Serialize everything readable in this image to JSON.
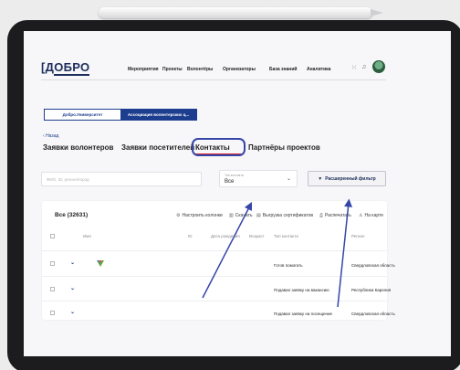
{
  "header": {
    "logo": "ДОБРО",
    "nav": [
      "Мероприятия",
      "Проекты",
      "Волонтёры",
      "Организаторы",
      "База знаний",
      "Аналитика"
    ]
  },
  "org_tabs": [
    "Добро.Университет",
    "Ассоциация волонтерских ц..."
  ],
  "back_label": "Назад",
  "section_tabs": [
    "Заявки волонтеров",
    "Заявки посетителей",
    "Контакты",
    "Партнёры проектов"
  ],
  "active_section": "Контакты",
  "filters": {
    "search_placeholder": "ФИО, ID, регион/город",
    "type_label": "Тип контакта",
    "type_value": "Все",
    "advanced_filter": "Расширенный фильтр"
  },
  "table": {
    "total": "Все (32631)",
    "actions": [
      "Настроить колонки",
      "Скачать",
      "Выгрузка сертификатов",
      "Распечатать",
      "На карте"
    ],
    "columns": [
      "Имя",
      "ID",
      "Дата рождения",
      "Возраст",
      "Тип контакта",
      "Регион"
    ],
    "rows": [
      {
        "type": "Готов помогать",
        "region": "Свердловская область"
      },
      {
        "type": "Подавал заявку на вакансию",
        "region": "Республика Карелия"
      },
      {
        "type": "Подавал заявку на посещение",
        "region": "Свердловская область"
      }
    ]
  },
  "colors": {
    "brand": "#1d2e5c",
    "accent_red": "#d6242b",
    "annotation": "#3646a8"
  },
  "icons": [
    "gear-icon",
    "download-icon",
    "certificate-icon",
    "printer-icon",
    "map-person-icon",
    "filter-icon",
    "grid-icon",
    "bell-icon"
  ]
}
